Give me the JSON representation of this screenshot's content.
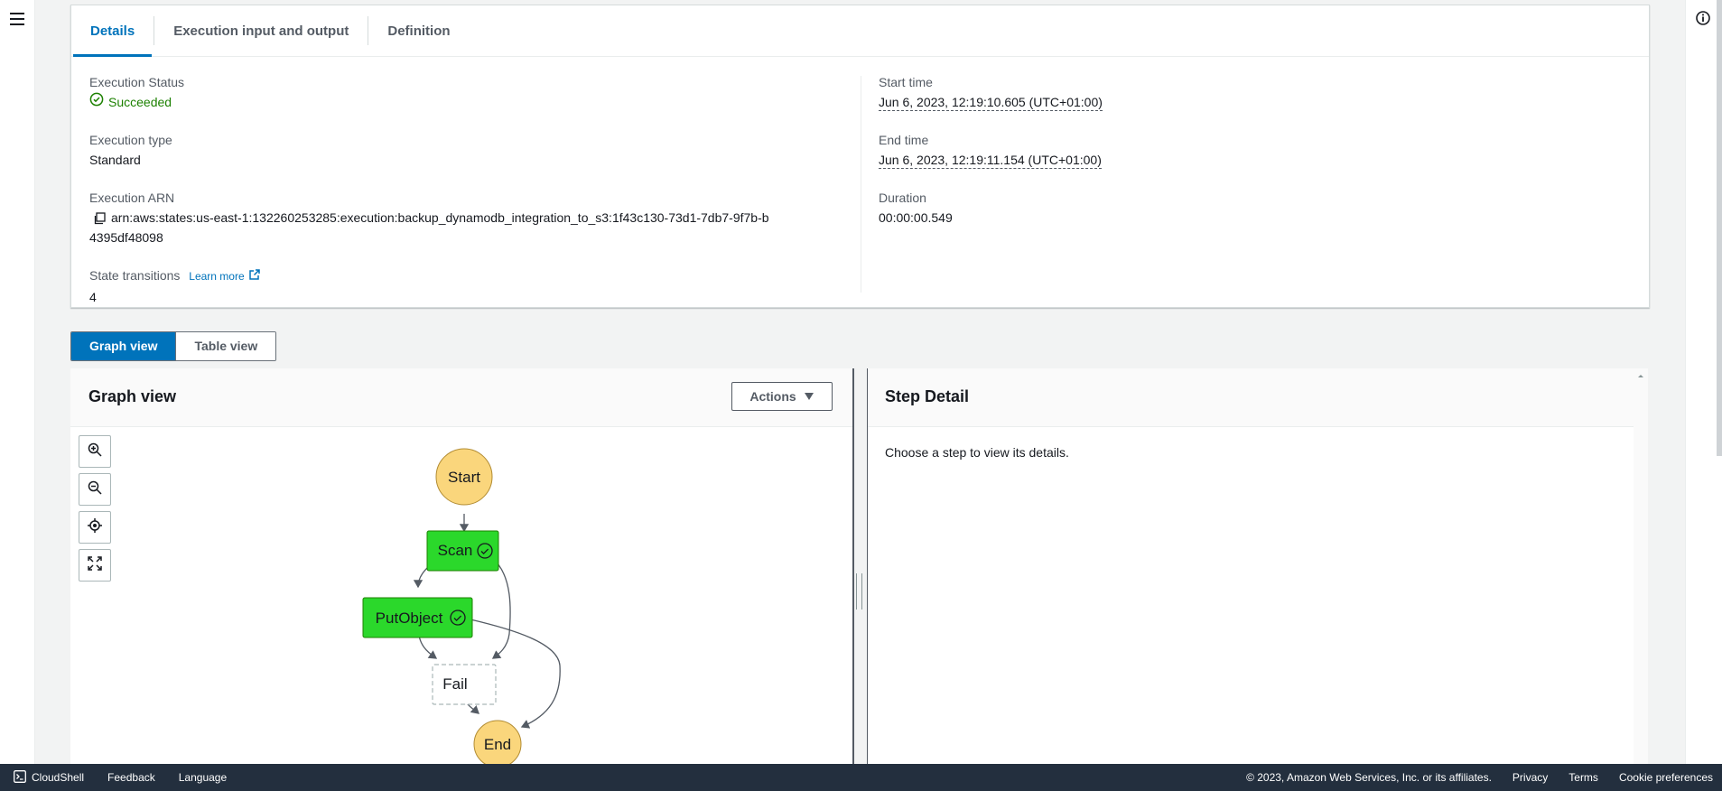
{
  "tabs": [
    {
      "label": "Details"
    },
    {
      "label": "Execution input and output"
    },
    {
      "label": "Definition"
    }
  ],
  "details": {
    "execution_status_label": "Execution Status",
    "execution_status_value": "Succeeded",
    "execution_type_label": "Execution type",
    "execution_type_value": "Standard",
    "execution_arn_label": "Execution ARN",
    "execution_arn_value": "arn:aws:states:us-east-1:132260253285:execution:backup_dynamodb_integration_to_s3:1f43c130-73d1-7db7-9f7b-b4395df48098",
    "state_transitions_label": "State transitions",
    "learn_more": "Learn more",
    "state_transitions_value": "4",
    "start_time_label": "Start time",
    "start_time_value": "Jun 6, 2023, 12:19:10.605 (UTC+01:00)",
    "end_time_label": "End time",
    "end_time_value": "Jun 6, 2023, 12:19:11.154 (UTC+01:00)",
    "duration_label": "Duration",
    "duration_value": "00:00:00.549"
  },
  "view_toggle": {
    "graph_label": "Graph view",
    "table_label": "Table view",
    "selected": "Graph view"
  },
  "graph": {
    "title": "Graph view",
    "actions_label": "Actions",
    "nodes": {
      "start": "Start",
      "scan": "Scan",
      "putobject": "PutObject",
      "fail": "Fail",
      "end": "End"
    },
    "colors": {
      "succeeded": "#2bd82b",
      "start_end": "#fad67c",
      "not_run_border": "#aab7b8"
    }
  },
  "step_detail": {
    "title": "Step Detail",
    "empty_text": "Choose a step to view its details."
  },
  "footer": {
    "cloudshell": "CloudShell",
    "feedback": "Feedback",
    "language": "Language",
    "copyright": "© 2023, Amazon Web Services, Inc. or its affiliates.",
    "privacy": "Privacy",
    "terms": "Terms",
    "cookie_preferences": "Cookie preferences"
  },
  "theme": {
    "accent": "#0073bb",
    "success": "#1d8102",
    "footer_bg": "#232f3e"
  }
}
